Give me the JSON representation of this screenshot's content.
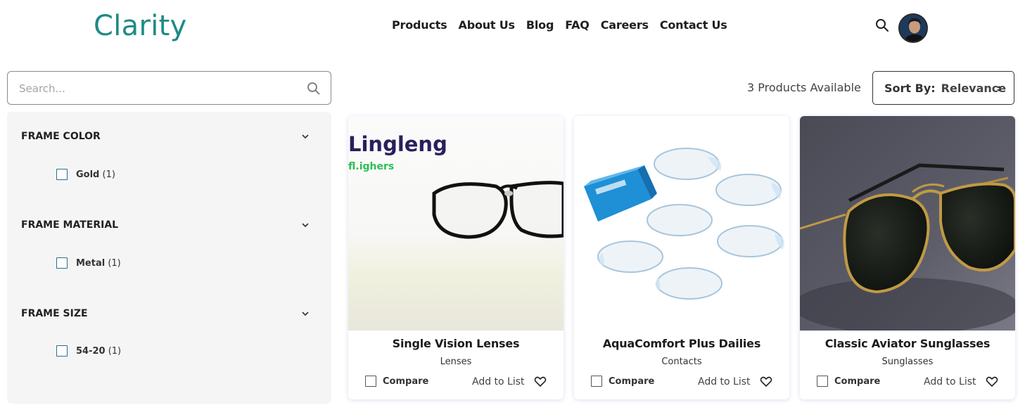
{
  "brand": {
    "name": "Clarity",
    "color": "#1e8a86"
  },
  "nav": {
    "items": [
      "Products",
      "About Us",
      "Blog",
      "FAQ",
      "Careers",
      "Contact Us"
    ]
  },
  "header": {
    "search_icon": "search-icon",
    "avatar": "user-avatar"
  },
  "search": {
    "placeholder": "Search...",
    "value": "",
    "icon": "search-icon"
  },
  "filters": [
    {
      "title": "FRAME COLOR",
      "options": [
        {
          "label": "Gold",
          "count": "(1)"
        }
      ]
    },
    {
      "title": "FRAME MATERIAL",
      "options": [
        {
          "label": "Metal",
          "count": "(1)"
        }
      ]
    },
    {
      "title": "FRAME SIZE",
      "options": [
        {
          "label": "54-20",
          "count": "(1)"
        }
      ]
    }
  ],
  "toolbar": {
    "count_text": "3 Products Available",
    "sort_label": "Sort By:",
    "sort_value": "Relevance"
  },
  "products": [
    {
      "title": "Single Vision Lenses",
      "category": "Lenses",
      "image_text": {
        "line1": "Lingleng",
        "line2": "fl.ighers"
      }
    },
    {
      "title": "AquaComfort Plus Dailies",
      "category": "Contacts"
    },
    {
      "title": "Classic Aviator Sunglasses",
      "category": "Sunglasses"
    }
  ],
  "card_actions": {
    "compare_label": "Compare",
    "add_to_list_label": "Add to List"
  },
  "colors": {
    "accent": "#1e8a86",
    "checkbox_border": "#2f6b88",
    "filter_bg": "#f5f5f5"
  }
}
